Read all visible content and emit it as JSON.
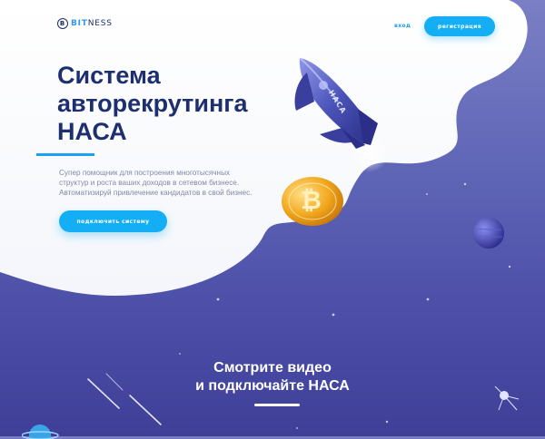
{
  "header": {
    "logo": {
      "badge": "B",
      "accent": "BIT",
      "rest": "NESS"
    },
    "login_label": "вход",
    "register_label": "регистрация"
  },
  "hero": {
    "title_lines": [
      "Система",
      "авторекрутинга",
      "НАСА"
    ],
    "description_lines": [
      "Супер помощник для построения многотысячных",
      "структур и роста ваших доходов в сетевом бизнесе.",
      "Автоматизируй привлечение кандидатов в свой бизнес."
    ],
    "cta_label": "подключить систему"
  },
  "rocket": {
    "label": "НАСА"
  },
  "coin": {
    "symbol": "₿"
  },
  "video": {
    "title_lines": [
      "Смотрите видео",
      "и подключайте НАСА"
    ]
  },
  "colors": {
    "accent": "#14aef4",
    "title": "#1e2f70",
    "background_top": "#7a7fc4",
    "background_bottom": "#3f3f98"
  }
}
